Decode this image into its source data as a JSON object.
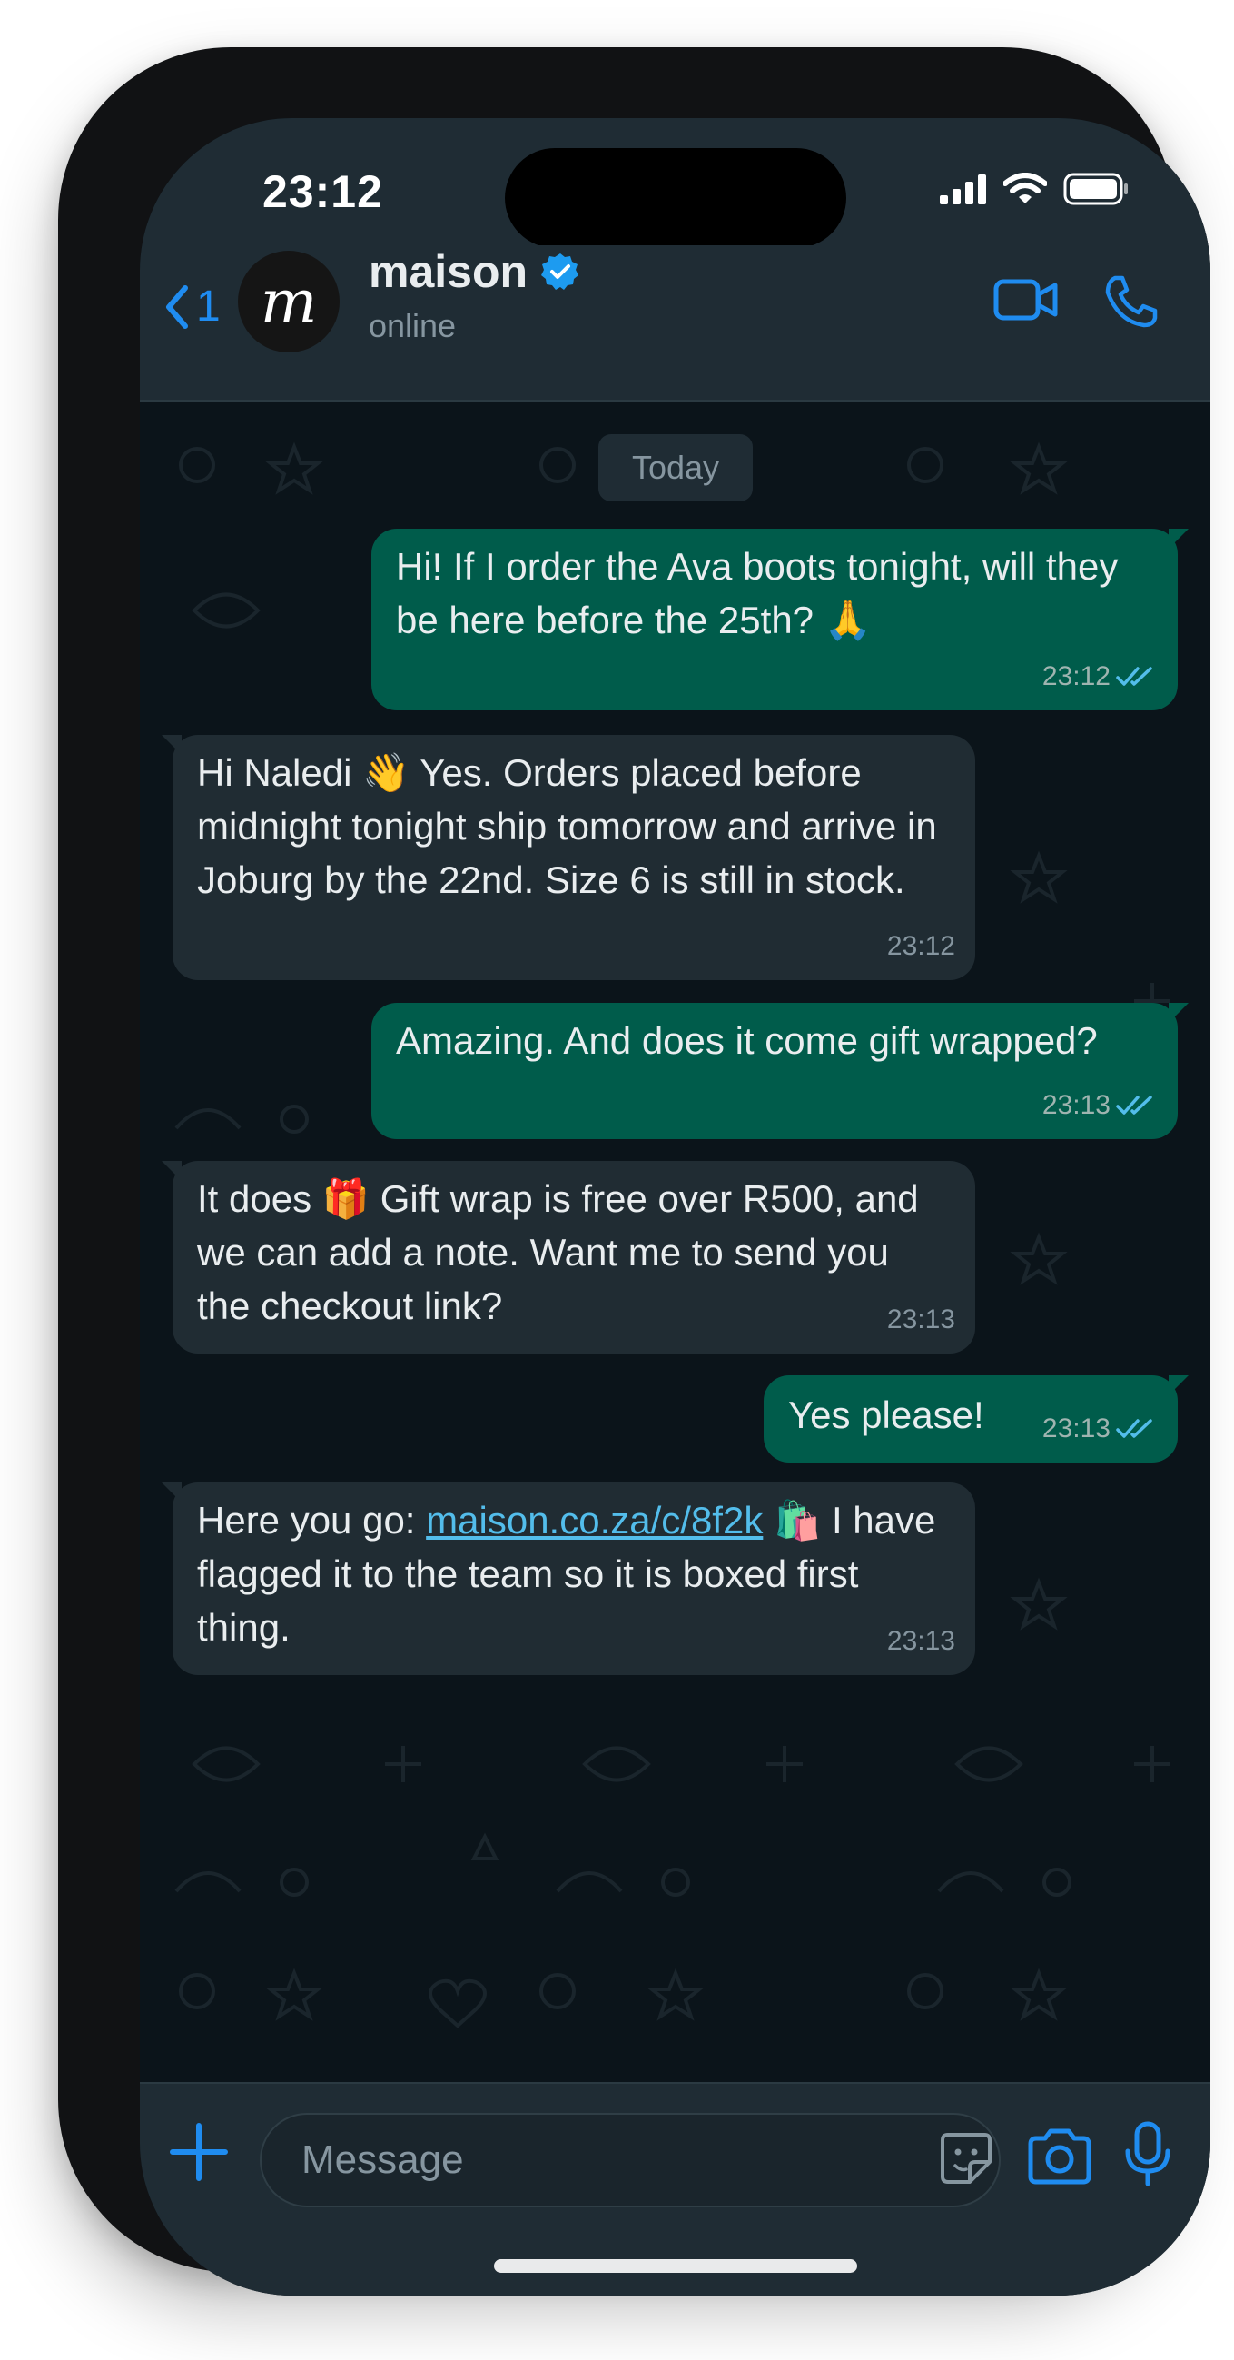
{
  "status_bar": {
    "time": "23:12"
  },
  "header": {
    "back_count": "1",
    "avatar_letter": "m",
    "contact_name": "maison",
    "presence": "online"
  },
  "chat": {
    "date_label": "Today",
    "messages": [
      {
        "direction": "outgoing",
        "text": "Hi! If I order the Ava boots tonight, will they be here before the 25th? 🙏",
        "time": "23:12",
        "status": "read"
      },
      {
        "direction": "incoming",
        "text": "Hi Naledi 👋 Yes. Orders placed before midnight tonight ship tomorrow and arrive in Joburg by the 22nd. Size 6 is still in stock.",
        "time": "23:12"
      },
      {
        "direction": "outgoing",
        "text": "Amazing. And does it come gift wrapped?",
        "time": "23:13",
        "status": "read"
      },
      {
        "direction": "incoming",
        "text": "It does 🎁 Gift wrap is free over R500, and we can add a note. Want me to send you the checkout link?",
        "time": "23:13"
      },
      {
        "direction": "outgoing",
        "text": "Yes please!",
        "time": "23:13",
        "status": "read"
      },
      {
        "direction": "incoming",
        "text_before": "Here you go: ",
        "link": "maison.co.za/c/8f2k",
        "text_after": " 🛍️ I have flagged it to the team so it is boxed first thing.",
        "time": "23:13"
      }
    ]
  },
  "composer": {
    "placeholder": "Message"
  },
  "colors": {
    "accent": "#1f8cf0",
    "outgoing_bubble": "#005c4b",
    "incoming_bubble": "#202c33",
    "background": "#0b141a",
    "read_ticks": "#53bdeb"
  },
  "icons": [
    "chevron-left-icon",
    "verified-badge-icon",
    "video-call-icon",
    "phone-icon",
    "plus-icon",
    "sticker-icon",
    "camera-icon",
    "microphone-icon",
    "signal-icon",
    "wifi-icon",
    "battery-icon",
    "double-check-icon"
  ]
}
